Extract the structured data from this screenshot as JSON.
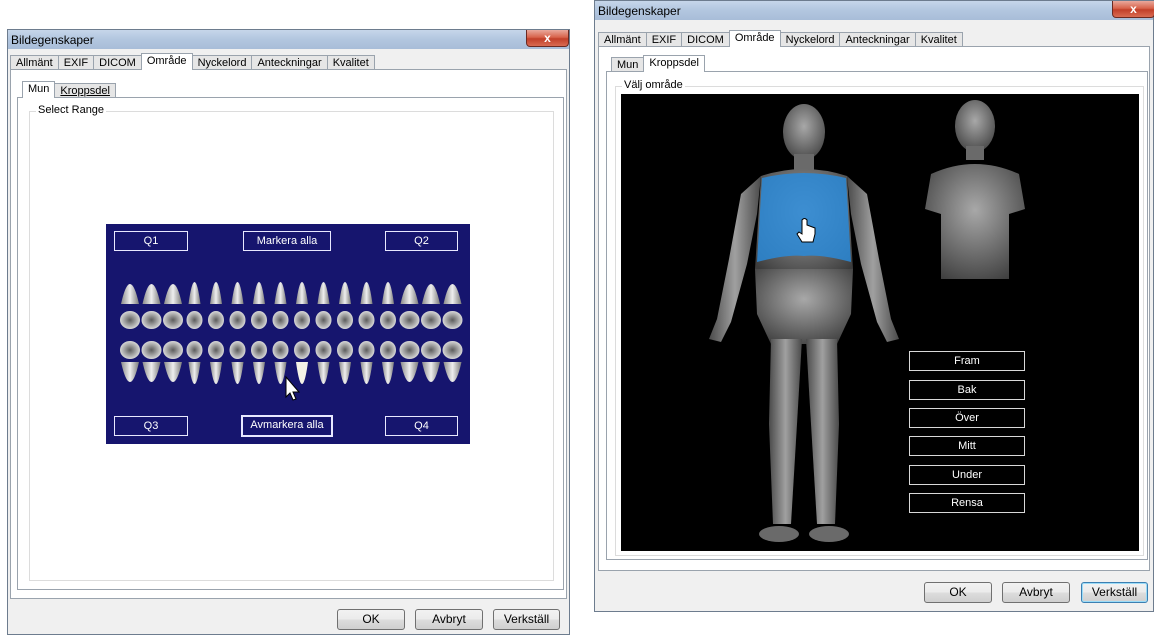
{
  "left_window": {
    "title": "Bildegenskaper",
    "close": "x",
    "tabs": [
      "Allmänt",
      "EXIF",
      "DICOM",
      "Område",
      "Nyckelord",
      "Anteckningar",
      "Kvalitet"
    ],
    "active_tab": "Område",
    "subtabs": [
      "Mun",
      "Kroppsdel"
    ],
    "active_subtab": "Mun",
    "group_label": "Select Range",
    "quadrants": {
      "q1": "Q1",
      "q2": "Q2",
      "q3": "Q3",
      "q4": "Q4"
    },
    "select_all": "Markera alla",
    "deselect_all": "Avmarkera alla",
    "buttons": {
      "ok": "OK",
      "cancel": "Avbryt",
      "apply": "Verkställ"
    }
  },
  "right_window": {
    "title": "Bildegenskaper",
    "close": "x",
    "tabs": [
      "Allmänt",
      "EXIF",
      "DICOM",
      "Område",
      "Nyckelord",
      "Anteckningar",
      "Kvalitet"
    ],
    "active_tab": "Område",
    "subtabs": [
      "Mun",
      "Kroppsdel"
    ],
    "active_subtab": "Kroppsdel",
    "group_label": "Välj område",
    "body_buttons": [
      "Fram",
      "Bak",
      "Över",
      "Mitt",
      "Under",
      "Rensa"
    ],
    "buttons": {
      "ok": "OK",
      "cancel": "Avbryt",
      "apply": "Verkställ"
    }
  },
  "colors": {
    "teeth_bg": "#16156e",
    "body_bg": "#000000",
    "selected_region": "#2a8ad8",
    "selected_tooth": "#f4f2e6"
  }
}
